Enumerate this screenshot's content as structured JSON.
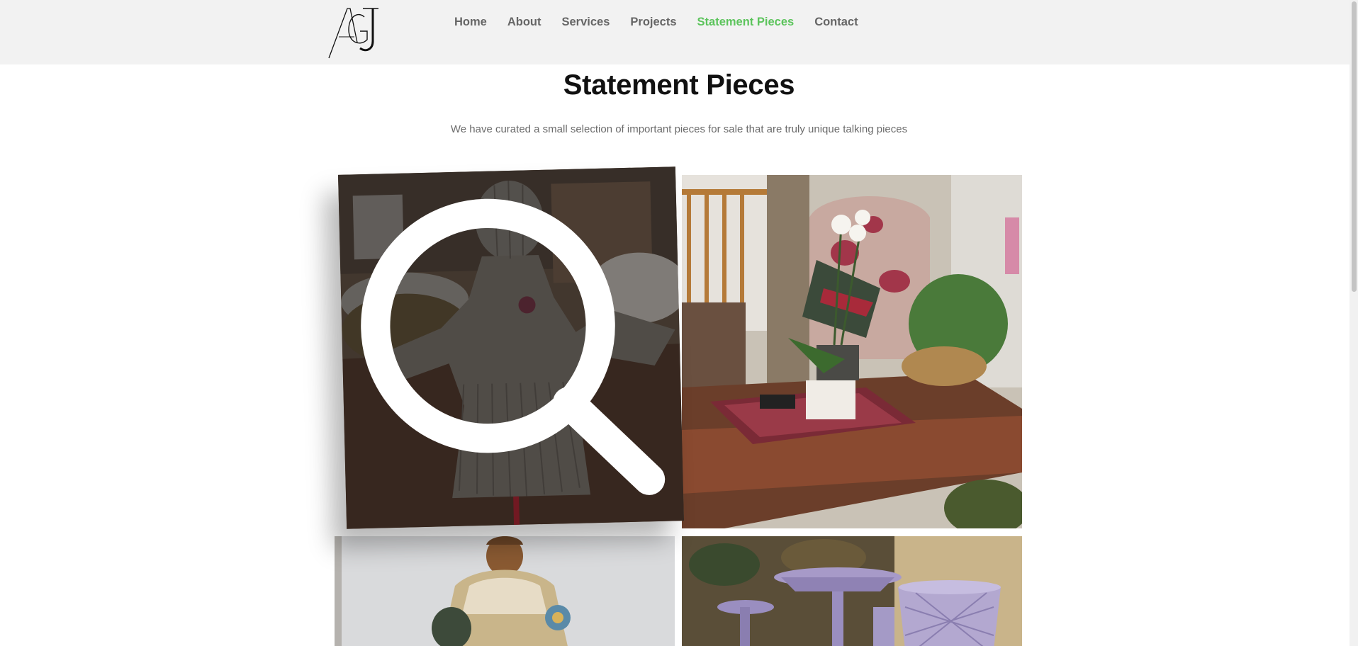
{
  "logo": {
    "text": "AGJ",
    "icon": "agj-logo"
  },
  "nav": {
    "items": [
      {
        "label": "Home",
        "active": false
      },
      {
        "label": "About",
        "active": false
      },
      {
        "label": "Services",
        "active": false
      },
      {
        "label": "Projects",
        "active": false
      },
      {
        "label": "Statement Pieces",
        "active": true
      },
      {
        "label": "Contact",
        "active": false
      }
    ],
    "active_color": "#5cc45c",
    "text_color": "#666666"
  },
  "page": {
    "title": "Statement Pieces",
    "subtitle": "We have curated a small selection of important pieces for sale that are truly unique talking pieces"
  },
  "gallery": {
    "items": [
      {
        "subject": "yarn doll on wooden table",
        "hovered": true,
        "hover_icon": "search-icon"
      },
      {
        "subject": "living room with floral armchair, orchid and coffee table",
        "hovered": false
      },
      {
        "subject": "antique religious figurine statue",
        "hovered": false
      },
      {
        "subject": "lilac glass cake stand and goblets",
        "hovered": false
      }
    ]
  }
}
